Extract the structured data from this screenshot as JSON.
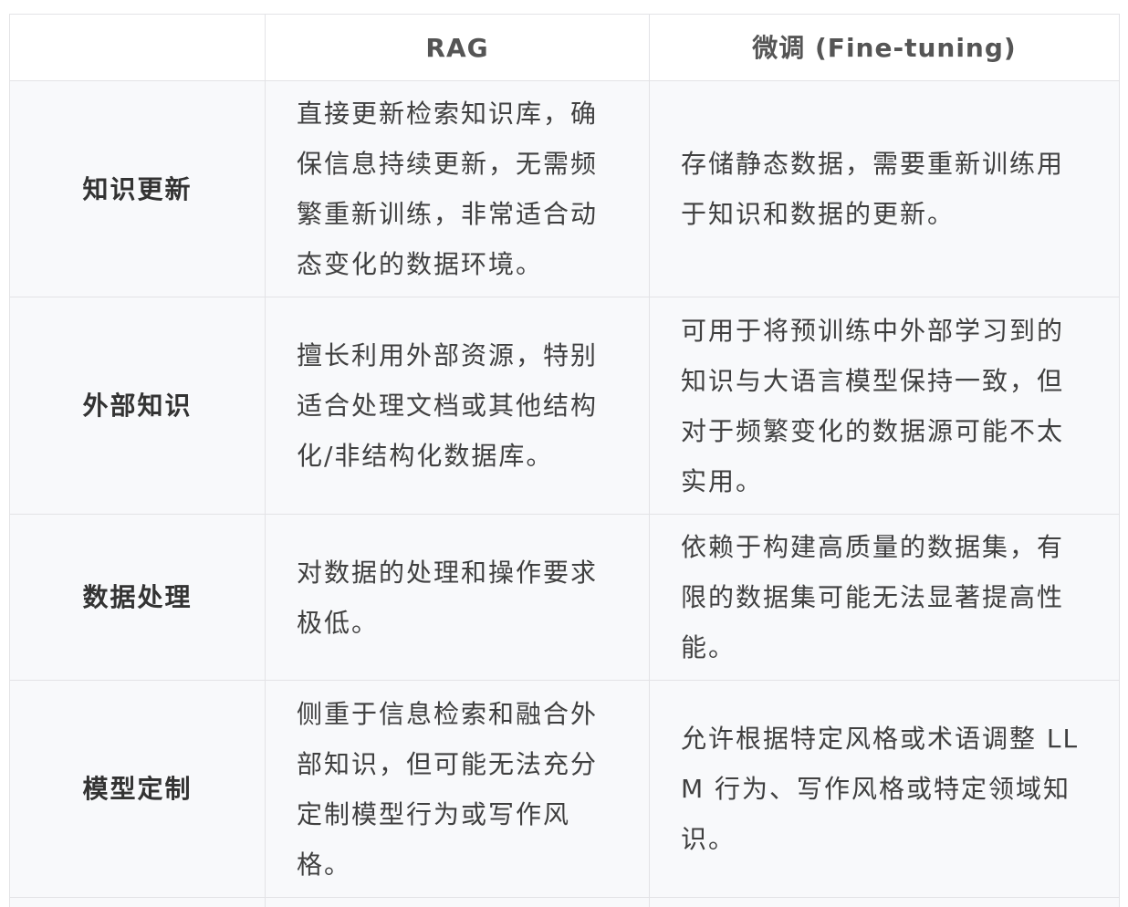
{
  "table": {
    "headers": [
      "",
      "RAG",
      "微调 (Fine-tuning)"
    ],
    "rows": [
      {
        "label": "知识更新",
        "rag": "直接更新检索知识库，确保信息持续更新，无需频繁重新训练，非常适合动态变化的数据环境。",
        "finetuning": "存储静态数据，需要重新训练用于知识和数据的更新。"
      },
      {
        "label": "外部知识",
        "rag": "擅长利用外部资源，特别适合处理文档或其他结构化/非结构化数据库。",
        "finetuning": "可用于将预训练中外部学习到的知识与大语言模型保持一致，但对于频繁变化的数据源可能不太实用。"
      },
      {
        "label": "数据处理",
        "rag": "对数据的处理和操作要求极低。",
        "finetuning": "依赖于构建高质量的数据集，有限的数据集可能无法显著提高性能。"
      },
      {
        "label": "模型定制",
        "rag": "侧重于信息检索和融合外部知识，但可能无法充分定制模型行为或写作风格。",
        "finetuning": "允许根据特定风格或术语调整 LLM 行为、写作风格或特定领域知识。"
      }
    ]
  }
}
